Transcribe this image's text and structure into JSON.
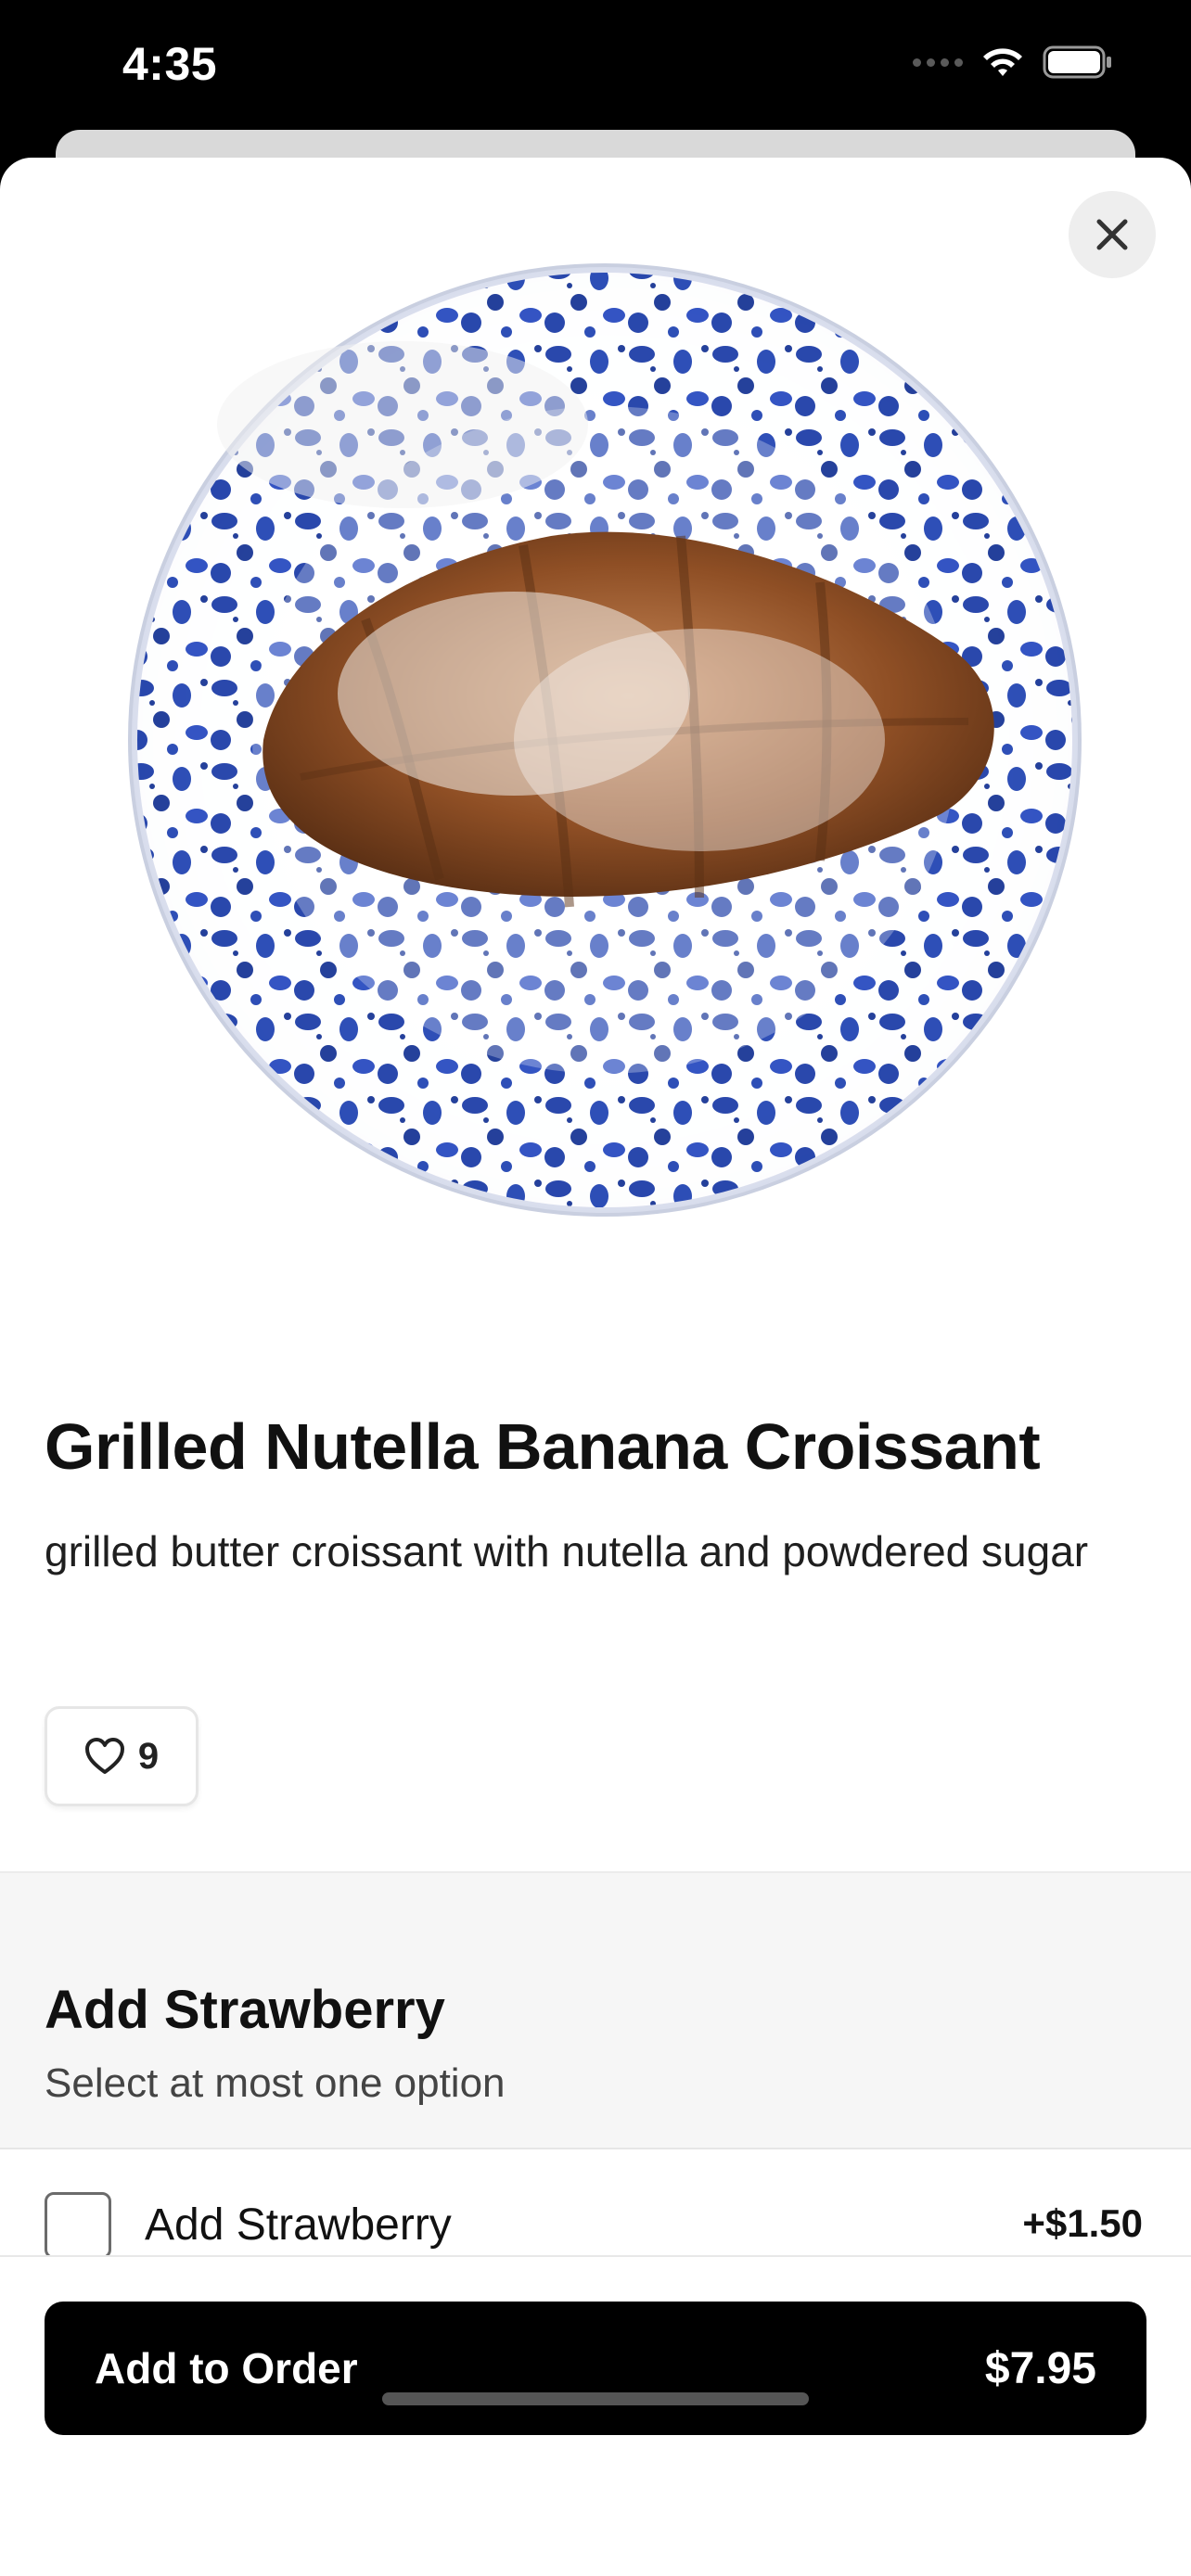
{
  "status_bar": {
    "time": "4:35"
  },
  "product": {
    "title": "Grilled Nutella Banana Croissant",
    "description": "grilled butter croissant with nutella and powdered sugar",
    "likes": "9"
  },
  "modifier_group": {
    "title": "Add Strawberry",
    "subtitle": "Select at most one option",
    "options": [
      {
        "label": "Add Strawberry",
        "price": "+$1.50",
        "checked": false
      }
    ]
  },
  "footer": {
    "button_label": "Add to Order",
    "total": "$7.95"
  },
  "colors": {
    "primary": "#000000",
    "plate_blue": "#1f3fa8",
    "croissant": "#9a5a2c"
  },
  "icons": [
    "close-icon",
    "heart-icon",
    "wifi-icon",
    "battery-icon",
    "signal-icon"
  ]
}
